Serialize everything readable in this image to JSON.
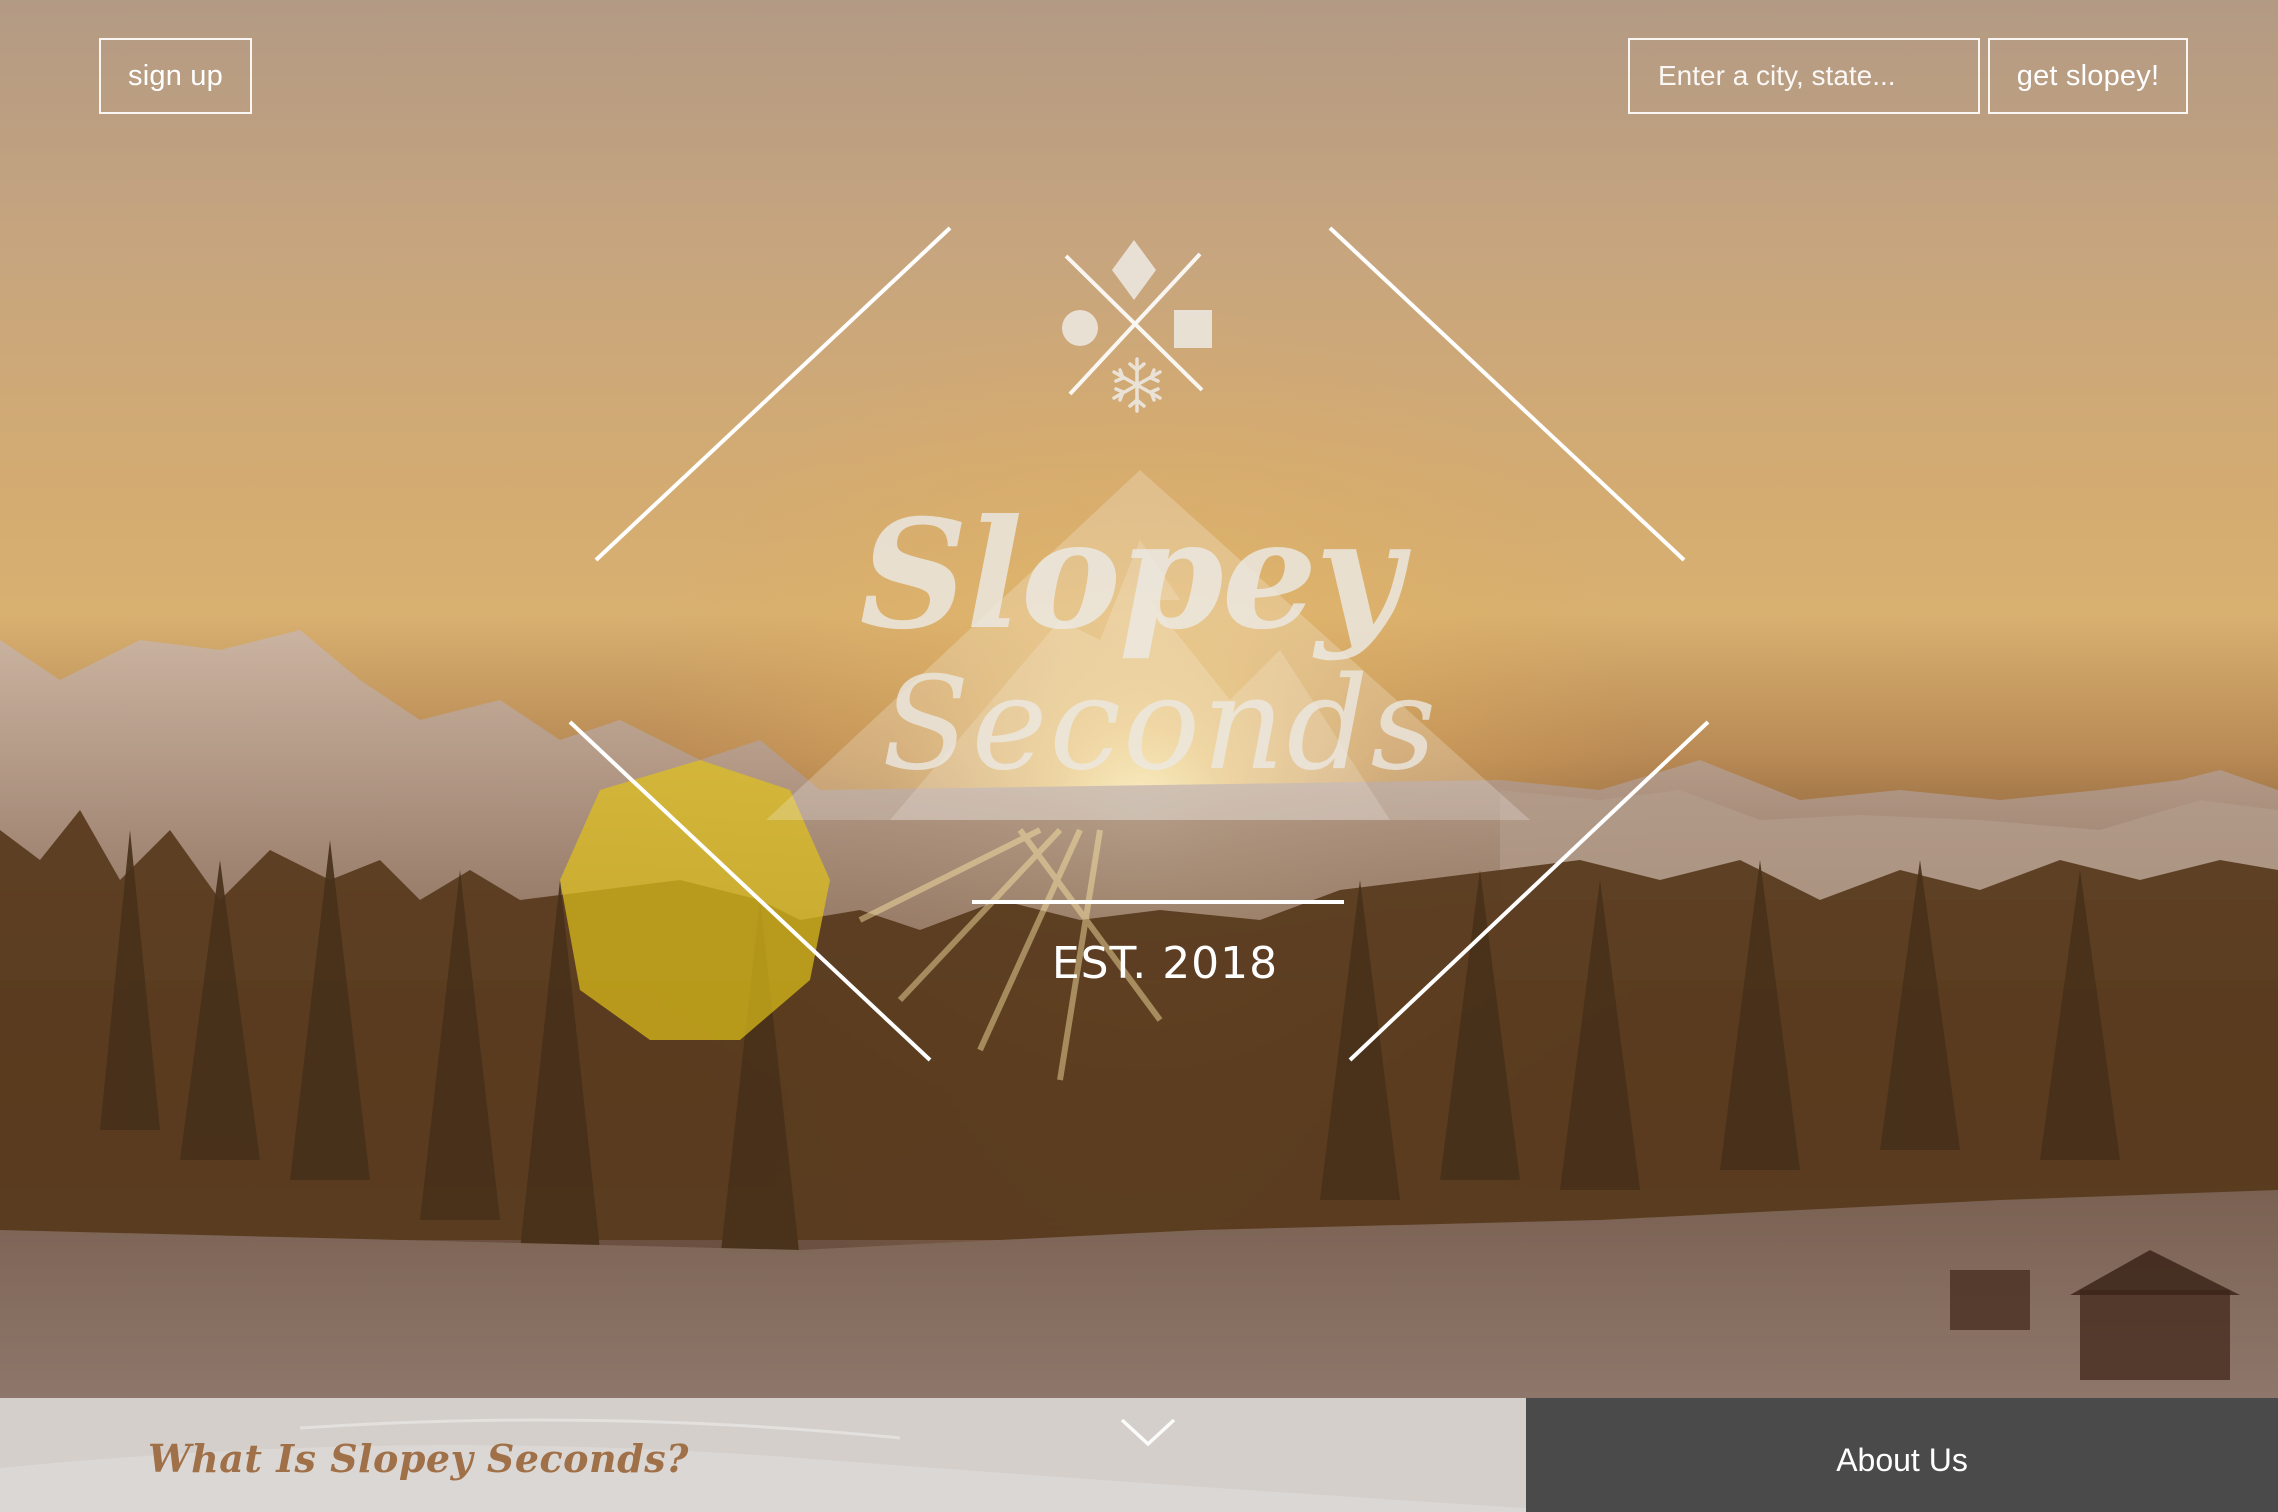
{
  "nav": {
    "signup_label": "sign up",
    "search_placeholder": "Enter a city, state...",
    "submit_label": "get slopey!"
  },
  "logo": {
    "title": "Slopey",
    "subtitle": "Seconds",
    "established": "EST. 2018",
    "icons": [
      "diamond-icon",
      "circle-icon",
      "square-icon",
      "snowflake-icon"
    ]
  },
  "footer_bar": {
    "heading": "What Is Slopey Seconds?",
    "about_label": "About Us",
    "scroll_icon": "chevron-down-icon"
  },
  "colors": {
    "heading_accent": "#a07048",
    "bar_light": "#d4cfcb",
    "bar_dark": "#4b4a4a"
  }
}
